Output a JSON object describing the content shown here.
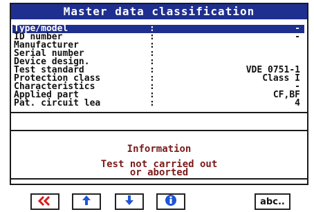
{
  "title": "Master data classification",
  "rows": [
    {
      "label": "Type/model",
      "value": "-",
      "selected": true
    },
    {
      "label": "ID number",
      "value": "-",
      "selected": false
    },
    {
      "label": "Manufacturer",
      "value": "",
      "selected": false
    },
    {
      "label": "Serial number",
      "value": "",
      "selected": false
    },
    {
      "label": "Device design.",
      "value": "",
      "selected": false
    },
    {
      "label": "Test standard",
      "value": "VDE 0751-1",
      "selected": false
    },
    {
      "label": "Protection class",
      "value": "Class I",
      "selected": false
    },
    {
      "label": "Characteristics",
      "value": "-",
      "selected": false
    },
    {
      "label": "Applied part",
      "value": "CF,BF",
      "selected": false
    },
    {
      "label": "Pat. circuit lea",
      "value": "4",
      "selected": false
    }
  ],
  "info": {
    "title": "Information",
    "line1": "Test not carried out",
    "line2": "or aborted"
  },
  "buttons": {
    "abc_label": "abc.."
  },
  "colors": {
    "title_bg": "#1f2f8f",
    "selected_bg": "#1f2f8f",
    "info_text": "#7a1a1a",
    "arrow_red": "#d81b1b",
    "arrow_blue": "#1f55d6"
  }
}
